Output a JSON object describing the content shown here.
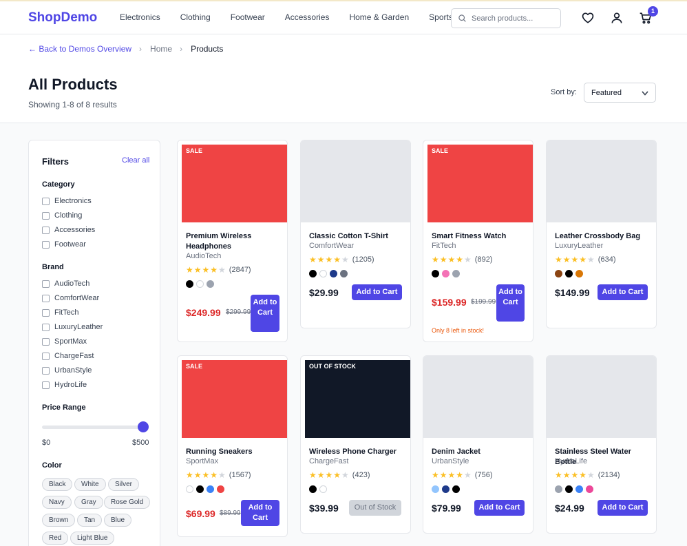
{
  "header": {
    "logo": "ShopDemo",
    "nav": [
      "Electronics",
      "Clothing",
      "Footwear",
      "Accessories",
      "Home & Garden",
      "Sports"
    ],
    "search_placeholder": "Search products...",
    "cart_count": "1",
    "icons": [
      "search-icon",
      "heart-icon",
      "user-icon",
      "cart-icon"
    ]
  },
  "breadcrumb": {
    "back": "← Back to Demos Overview",
    "home": "Home",
    "current": "Products",
    "separator": "›"
  },
  "page": {
    "title": "All Products",
    "results": "Showing 1-8 of 8 results",
    "sort_label": "Sort by:",
    "sort_value": "Featured"
  },
  "filters": {
    "title": "Filters",
    "clear": "Clear all",
    "category_title": "Category",
    "categories": [
      "Electronics",
      "Clothing",
      "Accessories",
      "Footwear"
    ],
    "brand_title": "Brand",
    "brands": [
      "AudioTech",
      "ComfortWear",
      "FitTech",
      "LuxuryLeather",
      "SportMax",
      "ChargeFast",
      "UrbanStyle",
      "HydroLife"
    ],
    "price_title": "Price Range",
    "price_min": "$0",
    "price_max": "$500",
    "color_title": "Color",
    "colors": [
      "Black",
      "White",
      "Silver",
      "Navy",
      "Gray",
      "Rose Gold",
      "Brown",
      "Tan",
      "Blue",
      "Red",
      "Light Blue"
    ]
  },
  "products": [
    {
      "tag": "SALE",
      "name": "Premium Wireless Headphones",
      "brand": "AudioTech",
      "rating": 4,
      "count": "(2847)",
      "swatches": [
        "#000000",
        "#ffffff",
        "#9ca3af"
      ],
      "price": "$249.99",
      "original": "$299.99",
      "button": "Add to Cart",
      "stock_note": ""
    },
    {
      "tag": "",
      "name": "Classic Cotton T-Shirt",
      "brand": "ComfortWear",
      "rating": 4,
      "count": "(1205)",
      "swatches": [
        "#000000",
        "#ffffff",
        "#1e3a8a",
        "#6b7280"
      ],
      "price": "$29.99",
      "original": "",
      "button": "Add to Cart",
      "stock_note": ""
    },
    {
      "tag": "SALE",
      "name": "Smart Fitness Watch",
      "brand": "FitTech",
      "rating": 4,
      "count": "(892)",
      "swatches": [
        "#000000",
        "#f472b6",
        "#9ca3af"
      ],
      "price": "$159.99",
      "original": "$199.99",
      "button": "Add to Cart",
      "stock_note": "Only 8 left in stock!"
    },
    {
      "tag": "",
      "name": "Leather Crossbody Bag",
      "brand": "LuxuryLeather",
      "rating": 4,
      "count": "(634)",
      "swatches": [
        "#8b4513",
        "#000000",
        "#d97706"
      ],
      "price": "$149.99",
      "original": "",
      "button": "Add to Cart",
      "stock_note": ""
    },
    {
      "tag": "SALE",
      "name": "Running Sneakers",
      "brand": "SportMax",
      "rating": 4,
      "count": "(1567)",
      "swatches": [
        "#ffffff",
        "#000000",
        "#3b82f6",
        "#ef4444"
      ],
      "price": "$69.99",
      "original": "$89.99",
      "button": "Add to Cart",
      "stock_note": ""
    },
    {
      "tag": "OUT OF STOCK",
      "name": "Wireless Phone Charger",
      "brand": "ChargeFast",
      "rating": 4,
      "count": "(423)",
      "swatches": [
        "#000000",
        "#ffffff"
      ],
      "price": "$39.99",
      "original": "",
      "button": "Out of Stock",
      "stock_note": ""
    },
    {
      "tag": "",
      "name": "Denim Jacket",
      "brand": "UrbanStyle",
      "rating": 4,
      "count": "(756)",
      "swatches": [
        "#93c5fd",
        "#1e3a8a",
        "#000000"
      ],
      "price": "$79.99",
      "original": "",
      "button": "Add to Cart",
      "stock_note": ""
    },
    {
      "tag": "",
      "name": "Stainless Steel Water Bottle",
      "brand": "HydroLife",
      "rating": 4,
      "count": "(2134)",
      "swatches": [
        "#9ca3af",
        "#000000",
        "#3b82f6",
        "#ec4899"
      ],
      "price": "$24.99",
      "original": "",
      "button": "Add to Cart",
      "stock_note": ""
    }
  ],
  "colors": {
    "accent": "#4f46e5",
    "sale": "#ef4444",
    "sale_price": "#dc2626",
    "out_of_stock_bg": "#111827",
    "placeholder": "#e5e7eb"
  }
}
